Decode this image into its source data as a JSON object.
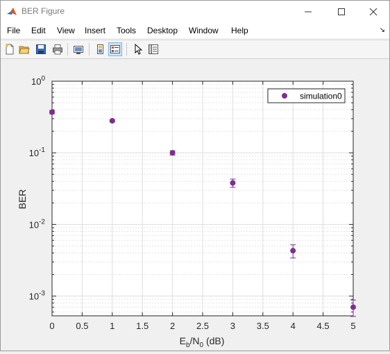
{
  "window": {
    "title": "BER Figure",
    "controls": {
      "minimize": "minimize",
      "maximize": "maximize",
      "close": "close"
    }
  },
  "menu": {
    "items": [
      "File",
      "Edit",
      "View",
      "Insert",
      "Tools",
      "Desktop",
      "Window",
      "Help"
    ],
    "dock_arrow": "↘"
  },
  "toolbar": {
    "icons": [
      "new-figure-icon",
      "open-file-icon",
      "save-icon",
      "print-icon",
      "link-plot-icon",
      "hide-plot-tools-icon",
      "show-plot-tools-icon",
      "edit-plot-icon",
      "property-inspector-icon"
    ]
  },
  "chart_data": {
    "type": "scatter",
    "ylabel": "BER",
    "xlabel_parts": {
      "E": "E",
      "b": "b",
      "slash_N": "/N",
      "zero": "0",
      "unit": " (dB)"
    },
    "xlim": [
      0,
      5
    ],
    "ylim": [
      0.00053,
      1
    ],
    "yscale": "log",
    "grid": true,
    "minor_grid": true,
    "legend_position": "top-right",
    "series": [
      {
        "name": "simulation0",
        "color": "#7e2f8e",
        "x": [
          0,
          1,
          2,
          3,
          4,
          5
        ],
        "y": [
          0.37,
          0.28,
          0.1,
          0.038,
          0.0043,
          0.0007
        ],
        "err_low": [
          0.35,
          0.27,
          0.093,
          0.033,
          0.0034,
          0.00052
        ],
        "err_high": [
          0.39,
          0.29,
          0.107,
          0.043,
          0.0052,
          0.00088
        ]
      }
    ],
    "xticks": [
      "0",
      "0.5",
      "1",
      "1.5",
      "2",
      "2.5",
      "3",
      "3.5",
      "4",
      "4.5",
      "5"
    ],
    "xtick_values": [
      0,
      0.5,
      1,
      1.5,
      2,
      2.5,
      3,
      3.5,
      4,
      4.5,
      5
    ],
    "yticks": [
      {
        "value": 1,
        "base": "10",
        "exp": "0"
      },
      {
        "value": 0.1,
        "base": "10",
        "exp": "-1"
      },
      {
        "value": 0.01,
        "base": "10",
        "exp": "-2"
      },
      {
        "value": 0.001,
        "base": "10",
        "exp": "-3"
      }
    ]
  }
}
